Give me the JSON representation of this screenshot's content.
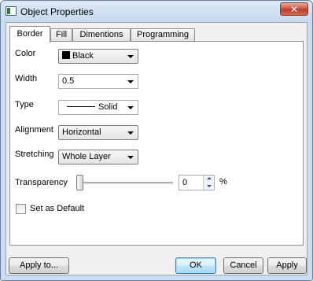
{
  "window": {
    "title": "Object Properties",
    "close_label": "✕"
  },
  "tabs": [
    {
      "label": "Border",
      "active": true
    },
    {
      "label": "Fill",
      "active": false
    },
    {
      "label": "Dimentions",
      "active": false
    },
    {
      "label": "Programming",
      "active": false
    }
  ],
  "form": {
    "color": {
      "label": "Color",
      "value": "Black",
      "swatch": "#000000"
    },
    "width": {
      "label": "Width",
      "value": "0.5"
    },
    "type": {
      "label": "Type",
      "value": "Solid"
    },
    "alignment": {
      "label": "Alignment",
      "value": "Horizontal"
    },
    "stretching": {
      "label": "Stretching",
      "value": "Whole Layer"
    },
    "transparency": {
      "label": "Transparency",
      "value": "0",
      "unit": "%",
      "slider_fraction": 0
    },
    "default": {
      "label": "Set as Default",
      "checked": false
    }
  },
  "buttons": {
    "apply_to": "Apply to...",
    "ok": "OK",
    "cancel": "Cancel",
    "apply": "Apply"
  },
  "icons": {
    "app": "window-app-icon",
    "close": "close-icon",
    "dropdown": "chevron-down-icon",
    "spin_up": "spin-up-icon",
    "spin_down": "spin-down-icon"
  }
}
